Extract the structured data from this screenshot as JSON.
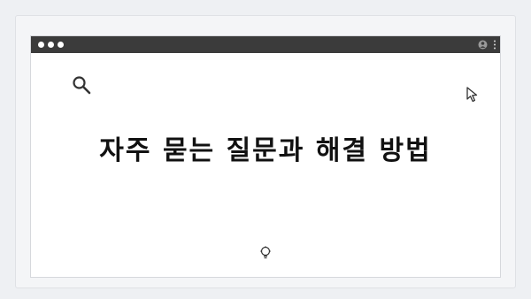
{
  "page": {
    "headline": "자주 묻는 질문과 해결 방법"
  },
  "icons": {
    "search": "search-icon",
    "cursor": "cursor-arrow-icon",
    "bulb": "lightbulb-icon",
    "user": "user-icon",
    "menu": "kebab-menu-icon"
  },
  "colors": {
    "titlebar": "#3b3b3b",
    "background": "#eef0f3",
    "text": "#111111"
  }
}
